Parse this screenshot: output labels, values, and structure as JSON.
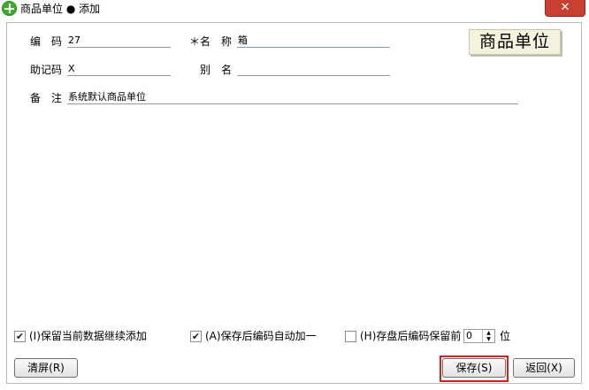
{
  "window": {
    "title": "商品单位 ● 添加",
    "close_label": "✕"
  },
  "form": {
    "code": {
      "label": "编　码",
      "value": "27"
    },
    "name": {
      "label": "＊名　称",
      "value": "箱"
    },
    "mnemonic": {
      "label": "助记码",
      "value": "X"
    },
    "alias": {
      "label": "别　名",
      "value": ""
    },
    "remark": {
      "label": "备　注",
      "value": "系统默认商品单位"
    }
  },
  "stamp_label": "商品单位",
  "options": {
    "keep_data": {
      "checked": true,
      "label": "(I)保留当前数据继续添加"
    },
    "auto_increment": {
      "checked": true,
      "label": "(A)保存后编码自动加一"
    },
    "keep_prefix": {
      "checked": false,
      "label": "(H)存盘后编码保留前",
      "digits": "0",
      "suffix": "位"
    }
  },
  "buttons": {
    "clear": "清屏(R)",
    "save": "保存(S)",
    "back": "返回(X)"
  }
}
